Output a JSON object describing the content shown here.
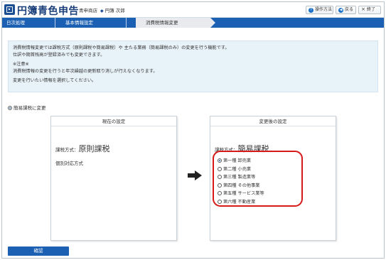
{
  "header": {
    "app_title": "円簿青色申告",
    "company": "青申商店",
    "user": "円簿 次郎",
    "help_label": "操作方法",
    "back_label": "戻る",
    "close_label": "終了"
  },
  "breadcrumb": {
    "items": [
      "日次処理",
      "基本情報設定",
      "消費税情報変更"
    ]
  },
  "info": {
    "line1": "消費税情報変更では課税方式（原則課税や簡易課税）や 主たる業務（簡易課税のみ）の変更を行う機能です。",
    "line2": "仕訳や期首残高が登録済みでも変更できます。",
    "note_title": "※注意※",
    "note_line": "消費税情報の変更を行うと年次繰越の更新取り消しが行えなくなります。",
    "instruction": "変更を行いたい情報を選択してください。"
  },
  "main_option": {
    "label": "簡易課税に変更"
  },
  "current": {
    "title": "現在の設定",
    "method_prefix": "課税方式：",
    "method_value": "原則課税",
    "sub_method": "個別対応方式"
  },
  "after": {
    "title": "変更後の設定",
    "method_prefix": "課税方式：",
    "method_value": "簡易課税",
    "options": [
      {
        "label": "第一種 卸売業",
        "selected": true
      },
      {
        "label": "第二種 小売業",
        "selected": false
      },
      {
        "label": "第三種 製造業等",
        "selected": false
      },
      {
        "label": "第四種 その他事業",
        "selected": false
      },
      {
        "label": "第五種 サービス業等",
        "selected": false
      },
      {
        "label": "第六種 不動産業",
        "selected": false
      }
    ]
  },
  "footer": {
    "confirm_label": "確認"
  },
  "colors": {
    "brand": "#1c60b3",
    "highlight": "#d61a1a",
    "info_bg": "#e8f2f9"
  }
}
